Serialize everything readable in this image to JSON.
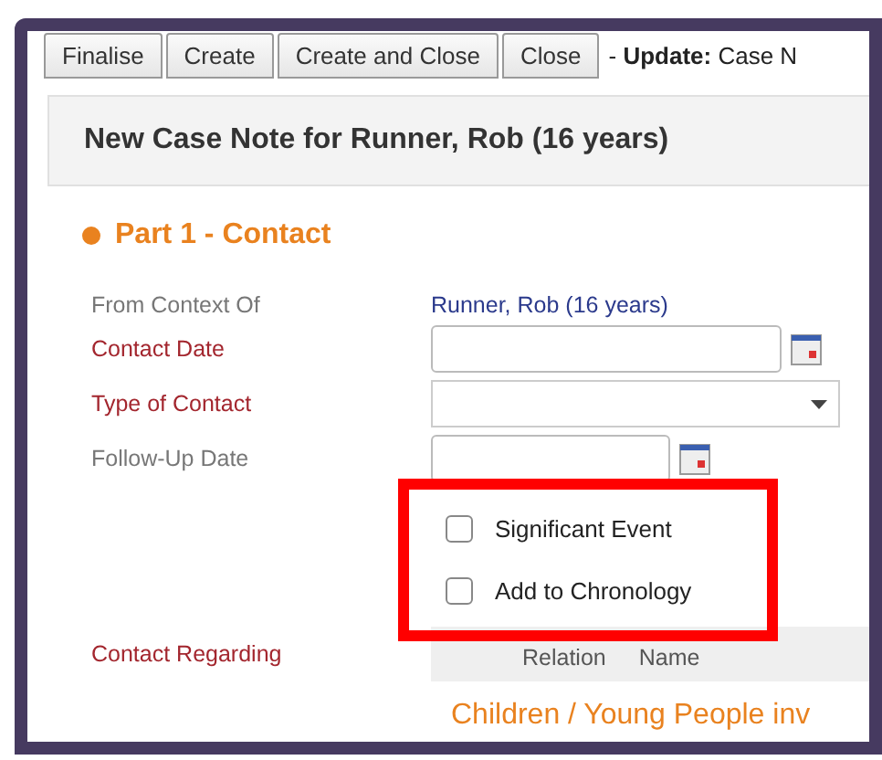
{
  "toolbar": {
    "buttons": [
      "Finalise",
      "Create",
      "Create and Close",
      "Close"
    ],
    "status": "- **Update:** Case N"
  },
  "header": {
    "title": "New Case Note for Runner, Rob (16 years)"
  },
  "section": {
    "title": "Part 1 - Contact"
  },
  "fields": [
    {
      "kind": "text",
      "label": "From Context Of",
      "required": false,
      "value": "Runner, Rob (16 years)"
    },
    {
      "kind": "date",
      "label": "Contact Date",
      "required": true
    },
    {
      "kind": "select",
      "label": "Type of Contact",
      "required": true
    },
    {
      "kind": "shortdate",
      "label": "Follow-Up Date",
      "required": false
    }
  ],
  "checkboxes": [
    {
      "label": "Significant Event",
      "checked": false
    },
    {
      "label": "Add to Chronology",
      "checked": false
    }
  ],
  "contact_regarding": {
    "label": "Contact Regarding",
    "columns": [
      "Relation",
      "Name"
    ],
    "group": "Children / Young People inv"
  }
}
